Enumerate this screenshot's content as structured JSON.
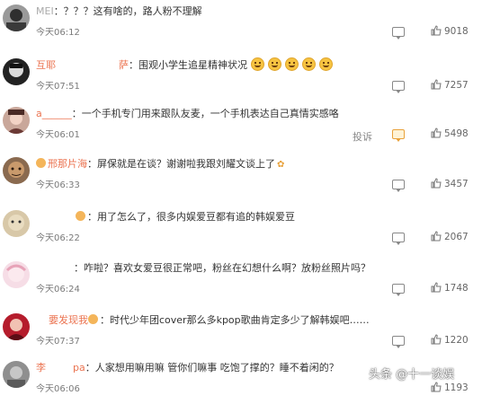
{
  "comments": [
    {
      "user": "MEI",
      "text": "：？？？这有啥的，路人粉不理解",
      "time": "今天06:12",
      "likes": "9018"
    },
    {
      "user": "互耶",
      "user2": "萨",
      "text": "：围观小学生追星精神状况",
      "time": "今天07:51",
      "likes": "7257"
    },
    {
      "user": "a______",
      "text": "：一个手机专门用来跟队友麦，一个手机表达自己真情实感咯",
      "time": "今天06:01",
      "report": "投诉",
      "likes": "5498"
    },
    {
      "user": "邢那片海",
      "text": "：屏保就是在谈？谢谢啦我跟刘耀文谈上了",
      "time": "今天06:33",
      "likes": "3457"
    },
    {
      "user": "",
      "text": "：用了怎么了，很多内娱爱豆都有追的韩娱爱豆",
      "time": "今天06:22",
      "likes": "2067"
    },
    {
      "user": "",
      "text": "：咋啦？喜欢女爱豆很正常吧，粉丝在幻想什么啊？放粉丝照片吗？",
      "time": "今天06:24",
      "likes": "1748"
    },
    {
      "user": "要发现我",
      "text": "：时代少年团cover那么多kpop歌曲肯定多少了解韩娱吧……",
      "time": "今天07:37",
      "likes": "1220"
    },
    {
      "user": "李",
      "user2": "pa",
      "text": "：人家想用嘛用嘛 管你们嘛事 吃饱了撑的？睡不着闲的？",
      "time": "今天06:06",
      "likes": "1193"
    }
  ],
  "watermark": "头条 @十一谈娱",
  "colors": {
    "username": "#eb7350",
    "highlight": "#e9a23b"
  }
}
